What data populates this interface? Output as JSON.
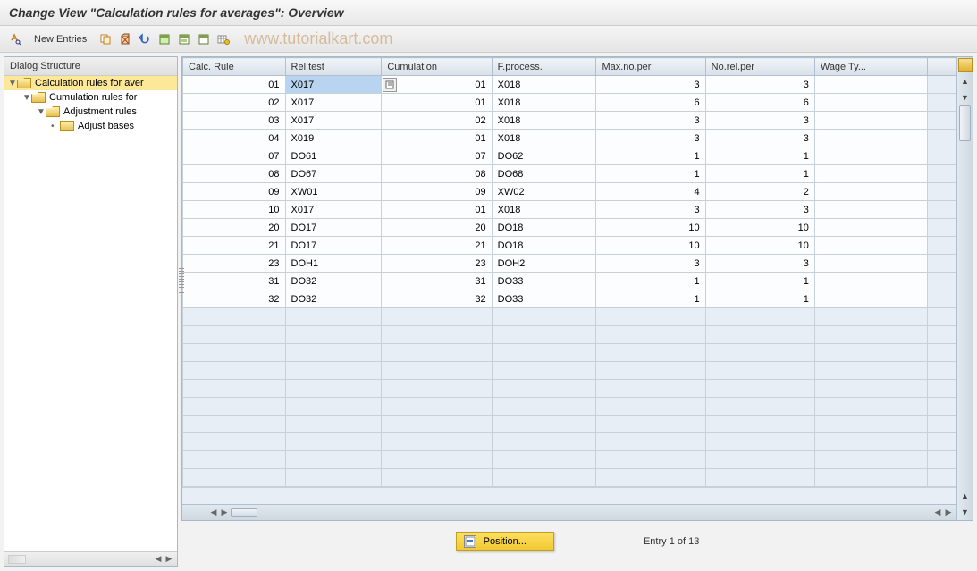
{
  "title": "Change View \"Calculation rules for averages\": Overview",
  "toolbar": {
    "new_entries": "New Entries"
  },
  "watermark": "www.tutorialkart.com",
  "sidebar": {
    "header": "Dialog Structure",
    "items": [
      {
        "label": "Calculation rules for aver",
        "level": 0,
        "selected": true,
        "open": true
      },
      {
        "label": "Cumulation rules for",
        "level": 1,
        "selected": false,
        "open": true
      },
      {
        "label": "Adjustment rules",
        "level": 2,
        "selected": false,
        "open": true
      },
      {
        "label": "Adjust bases",
        "level": 3,
        "selected": false,
        "open": false
      }
    ]
  },
  "table": {
    "columns": [
      "Calc. Rule",
      "Rel.test",
      "Cumulation",
      "F.process.",
      "Max.no.per",
      "No.rel.per",
      "Wage Ty..."
    ],
    "rows": [
      {
        "calc_rule": "01",
        "rel_test": "X017",
        "cumulation": "01",
        "f_process": "X018",
        "max_no_per": "3",
        "no_rel_per": "3",
        "wage_ty": ""
      },
      {
        "calc_rule": "02",
        "rel_test": "X017",
        "cumulation": "01",
        "f_process": "X018",
        "max_no_per": "6",
        "no_rel_per": "6",
        "wage_ty": ""
      },
      {
        "calc_rule": "03",
        "rel_test": "X017",
        "cumulation": "02",
        "f_process": "X018",
        "max_no_per": "3",
        "no_rel_per": "3",
        "wage_ty": ""
      },
      {
        "calc_rule": "04",
        "rel_test": "X019",
        "cumulation": "01",
        "f_process": "X018",
        "max_no_per": "3",
        "no_rel_per": "3",
        "wage_ty": ""
      },
      {
        "calc_rule": "07",
        "rel_test": "DO61",
        "cumulation": "07",
        "f_process": "DO62",
        "max_no_per": "1",
        "no_rel_per": "1",
        "wage_ty": ""
      },
      {
        "calc_rule": "08",
        "rel_test": "DO67",
        "cumulation": "08",
        "f_process": "DO68",
        "max_no_per": "1",
        "no_rel_per": "1",
        "wage_ty": ""
      },
      {
        "calc_rule": "09",
        "rel_test": "XW01",
        "cumulation": "09",
        "f_process": "XW02",
        "max_no_per": "4",
        "no_rel_per": "2",
        "wage_ty": ""
      },
      {
        "calc_rule": "10",
        "rel_test": "X017",
        "cumulation": "01",
        "f_process": "X018",
        "max_no_per": "3",
        "no_rel_per": "3",
        "wage_ty": ""
      },
      {
        "calc_rule": "20",
        "rel_test": "DO17",
        "cumulation": "20",
        "f_process": "DO18",
        "max_no_per": "10",
        "no_rel_per": "10",
        "wage_ty": ""
      },
      {
        "calc_rule": "21",
        "rel_test": "DO17",
        "cumulation": "21",
        "f_process": "DO18",
        "max_no_per": "10",
        "no_rel_per": "10",
        "wage_ty": ""
      },
      {
        "calc_rule": "23",
        "rel_test": "DOH1",
        "cumulation": "23",
        "f_process": "DOH2",
        "max_no_per": "3",
        "no_rel_per": "3",
        "wage_ty": ""
      },
      {
        "calc_rule": "31",
        "rel_test": "DO32",
        "cumulation": "31",
        "f_process": "DO33",
        "max_no_per": "1",
        "no_rel_per": "1",
        "wage_ty": ""
      },
      {
        "calc_rule": "32",
        "rel_test": "DO32",
        "cumulation": "32",
        "f_process": "DO33",
        "max_no_per": "1",
        "no_rel_per": "1",
        "wage_ty": ""
      }
    ],
    "empty_rows": 10
  },
  "footer": {
    "position_label": "Position...",
    "entry_text": "Entry 1 of 13"
  }
}
